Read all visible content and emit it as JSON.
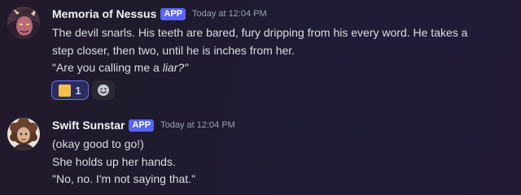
{
  "messages": [
    {
      "author": "Memoria of Nessus",
      "badge": "APP",
      "timestamp": "Today at 12:04 PM",
      "avatar_icon": "demon-portrait-avatar",
      "lines": [
        "The devil snarls.  His teeth are bared, fury dripping from his every word.  He takes a",
        "step closer, then two, until he is inches from her."
      ],
      "quote_prefix": "\"Are you calling me a ",
      "quote_italic": "liar?\"",
      "reactions": [
        {
          "emoji": "yellow-square-emoji",
          "count": "1",
          "active": true
        },
        {
          "emoji": "add-reaction-icon"
        }
      ]
    },
    {
      "author": "Swift Sunstar",
      "badge": "APP",
      "timestamp": "Today at 12:04 PM",
      "avatar_icon": "curly-haired-portrait-avatar",
      "lines": [
        "(okay good to go!)",
        "She holds up her hands.",
        "\"No, no.  I'm not saying that.\""
      ]
    }
  ],
  "colors": {
    "badge": "#5865f2",
    "reaction_active_border": "#6a72e8",
    "reaction_emoji": "#f3bf4f"
  }
}
